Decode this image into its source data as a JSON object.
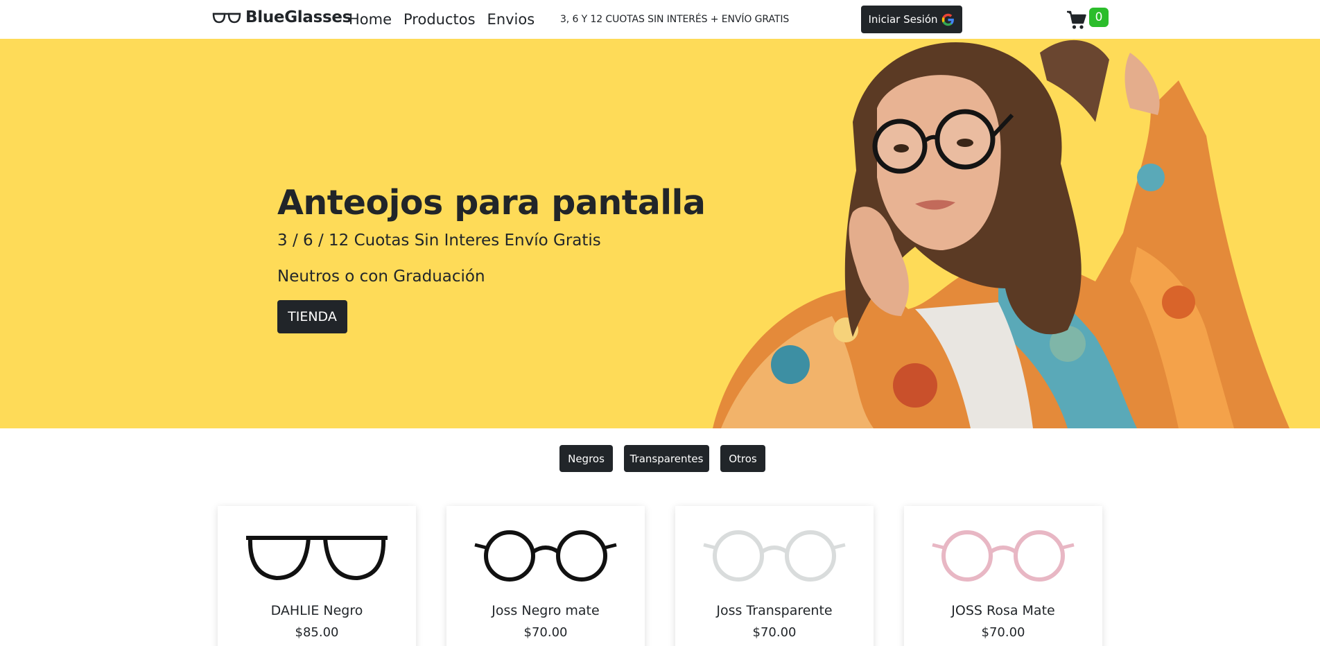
{
  "navbar": {
    "brand": "BlueGlasses",
    "links": [
      "Home",
      "Productos",
      "Envios"
    ],
    "promo": "3, 6 Y 12 CUOTAS SIN INTERÉS + ENVÍO GRATIS",
    "login_label": "Iniciar Sesión",
    "cart_count": "0"
  },
  "hero": {
    "title": "Anteojos para pantalla",
    "subtitle": "3 / 6 / 12 Cuotas Sin Interes Envío Gratis",
    "subtitle2": "Neutros o con Graduación",
    "button_label": "TIENDA"
  },
  "filters": [
    "Negros",
    "Transparentes",
    "Otros"
  ],
  "products": [
    {
      "name": "DAHLIE Negro",
      "price": "$85.00",
      "frame_color": "#111111"
    },
    {
      "name": "Joss Negro mate",
      "price": "$70.00",
      "frame_color": "#111111"
    },
    {
      "name": "Joss Transparente",
      "price": "$70.00",
      "frame_color": "#d9dcdc"
    },
    {
      "name": "JOSS Rosa Mate",
      "price": "$70.00",
      "frame_color": "#e8b7c4"
    }
  ],
  "colors": {
    "hero_background": "#fedb58",
    "dark": "#212529",
    "cart_badge": "#2bbd2b"
  }
}
